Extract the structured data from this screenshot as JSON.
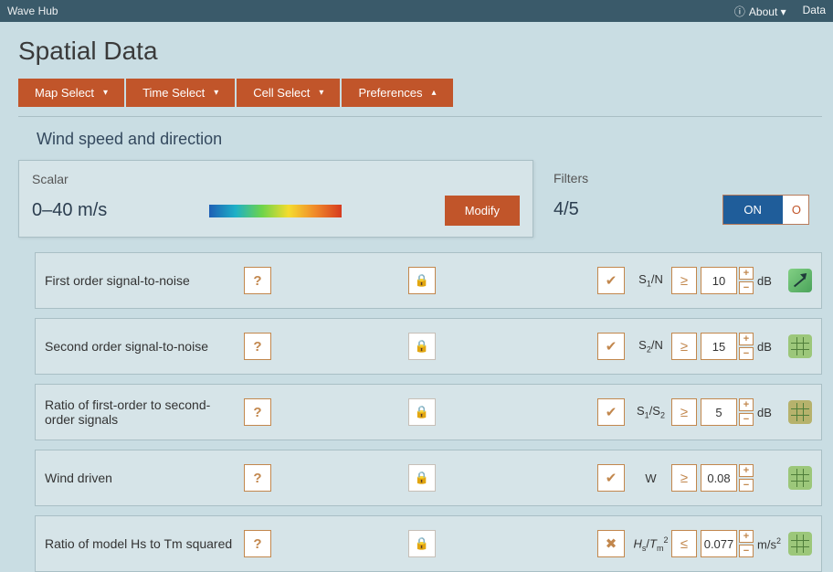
{
  "nav": {
    "brand": "Wave Hub",
    "about": "About",
    "data": "Data"
  },
  "page": {
    "title": "Spatial Data"
  },
  "menu": {
    "items": [
      {
        "label": "Map Select",
        "caret": "down"
      },
      {
        "label": "Time Select",
        "caret": "down"
      },
      {
        "label": "Cell Select",
        "caret": "down"
      },
      {
        "label": "Preferences",
        "caret": "up"
      }
    ]
  },
  "section": {
    "title": "Wind speed and direction"
  },
  "scalar": {
    "label": "Scalar",
    "range": "0–40 m/s",
    "modify": "Modify"
  },
  "filters_summary": {
    "label": "Filters",
    "count": "4/5",
    "on_label": "ON",
    "off_label": "O"
  },
  "filters": [
    {
      "name": "First order signal-to-noise",
      "locked": true,
      "active": true,
      "check_glyph": "✔",
      "symbol_html": "S<sub>1</sub>/N",
      "op": "≥",
      "value": "10",
      "unit_html": "dB",
      "swatch": "swatch-arrow"
    },
    {
      "name": "Second order signal-to-noise",
      "locked": false,
      "active": true,
      "check_glyph": "✔",
      "symbol_html": "S<sub>2</sub>/N",
      "op": "≥",
      "value": "15",
      "unit_html": "dB",
      "swatch": "swatch-grid-a"
    },
    {
      "name": "Ratio of first-order to second-order signals",
      "locked": false,
      "active": true,
      "check_glyph": "✔",
      "symbol_html": "S<sub>1</sub>/S<sub>2</sub>",
      "op": "≥",
      "value": "5",
      "unit_html": "dB",
      "swatch": "swatch-grid-b"
    },
    {
      "name": "Wind driven",
      "locked": false,
      "active": true,
      "check_glyph": "✔",
      "symbol_html": "W",
      "op": "≥",
      "value": "0.08",
      "unit_html": "",
      "swatch": "swatch-grid-c"
    },
    {
      "name": "Ratio of model Hs to Tm squared",
      "locked": false,
      "active": false,
      "check_glyph": "✖",
      "symbol_html": "<i>H</i><sub>s</sub>/<i>T</i><sub>m</sub><sup>2</sup>",
      "op": "≤",
      "value": "0.077",
      "unit_html": "m/s<sup>2</sup>",
      "swatch": "swatch-grid-d"
    }
  ]
}
